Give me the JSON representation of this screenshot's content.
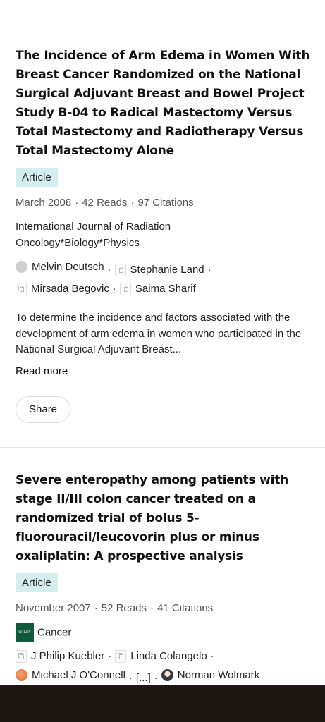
{
  "articles": [
    {
      "title": "The Incidence of Arm Edema in Women With Breast Cancer Randomized on the National Surgical Adjuvant Breast and Bowel Project Study B-04 to Radical Mastectomy Versus Total Mastectomy and Radiotherapy Versus Total Mastectomy Alone",
      "type": "Article",
      "date": "March 2008",
      "reads": "42 Reads",
      "citations": "97 Citations",
      "journal": "International Journal of Radiation Oncology*Biology*Physics",
      "authors": [
        "Melvin Deutsch",
        "Stephanie Land",
        "Mirsada Begovic",
        "Saima Sharif"
      ],
      "abstract": "To determine the incidence and factors associated with the development of arm edema in women who participated in the National Surgical Adjuvant Breast...",
      "read_more": "Read more",
      "share": "Share"
    },
    {
      "title": "Severe enteropathy among patients with stage II/III colon cancer treated on a randomized trial of bolus 5-fluorouracil/leucovorin plus or minus oxaliplatin: A prospective analysis",
      "type": "Article",
      "date": "November 2007",
      "reads": "52 Reads",
      "citations": "41 Citations",
      "journal": "Cancer",
      "journal_logo_text": "WILEY",
      "authors": [
        "J Philip Kuebler",
        "Linda Colangelo",
        "Michael J O'Connell",
        "[...]",
        "Norman Wolmark"
      ]
    }
  ],
  "separator": "·",
  "colors": {
    "badge_bg": "#d4eef0",
    "wiley_green": "#0e5a3a"
  }
}
